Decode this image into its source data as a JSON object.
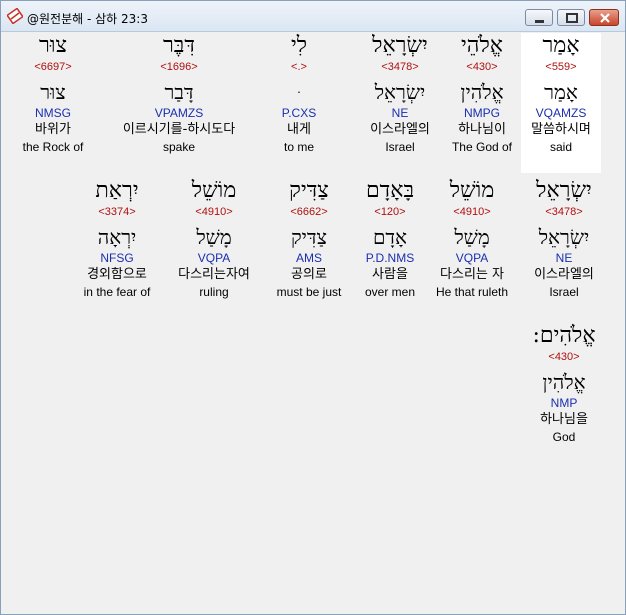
{
  "window": {
    "title": "@원전분해 - 삼하 23:3",
    "buttons": {
      "minimize": "minimize",
      "maximize": "maximize",
      "close": "close"
    }
  },
  "row1": [
    {
      "heb": "אָמַר",
      "strong": "<559>",
      "heb2": "אָמַר",
      "morph": "VQAMZS",
      "kor": "말씀하시며",
      "eng": "said"
    },
    {
      "heb": "אֱלֹהֵי",
      "strong": "<430>",
      "heb2": "אֱלֹהִין",
      "morph": "NMPG",
      "kor": "하나님이",
      "eng": "The God of"
    },
    {
      "heb": "יִשְׂרָאֵל",
      "strong": "<3478>",
      "heb2": "יִשְׂרָאֵל",
      "morph": "NE",
      "kor": "이스라엘의",
      "eng": "Israel"
    },
    {
      "heb": "לִי",
      "strong": "<.>",
      "heb2": "ּ",
      "morph": "P.CXS",
      "kor": "내게",
      "eng": "to me"
    },
    {
      "heb": "דִּבֶּר",
      "strong": "<1696>",
      "heb2": "דָּבַר",
      "morph": "VPAMZS",
      "kor": "이르시기를-하시도다",
      "eng": "spake"
    },
    {
      "heb": "צוּר",
      "strong": "<6697>",
      "heb2": "צוּר",
      "morph": "NMSG",
      "kor": "바위가",
      "eng": "the Rock of"
    }
  ],
  "row2": [
    {
      "heb": "יִשְׂרָאֵל",
      "strong": "<3478>",
      "heb2": "יִשְׂרָאֵל",
      "morph": "NE",
      "kor": "이스라엘의",
      "eng": "Israel"
    },
    {
      "heb": "מוֹשֵׁל",
      "strong": "<4910>",
      "heb2": "מָשַׁל",
      "morph": "VQPA",
      "kor": "다스리는 자",
      "eng": "He that ruleth"
    },
    {
      "heb": "בָּאָדָם",
      "strong": "<120>",
      "heb2": "אָדָם",
      "morph": "P.D.NMS",
      "kor": "사람을",
      "eng": "over men"
    },
    {
      "heb": "צַדִּיק",
      "strong": "<6662>",
      "heb2": "צַדִּיק",
      "morph": "AMS",
      "kor": "공의로",
      "eng": "must be just"
    },
    {
      "heb": "מוֹשֵׁל",
      "strong": "<4910>",
      "heb2": "מָשַׁל",
      "morph": "VQPA",
      "kor": "다스리는자여",
      "eng": "ruling"
    },
    {
      "heb": "יִרְאַת",
      "strong": "<3374>",
      "heb2": "יִרְאָה",
      "morph": "NFSG",
      "kor": "경외함으로",
      "eng": "in the fear of"
    }
  ],
  "row3": [
    {
      "heb": "אֱלֹהִים:",
      "strong": "<430>",
      "heb2": "אֱלֹהִין",
      "morph": "NMP",
      "kor": "하나님을",
      "eng": "God"
    }
  ]
}
